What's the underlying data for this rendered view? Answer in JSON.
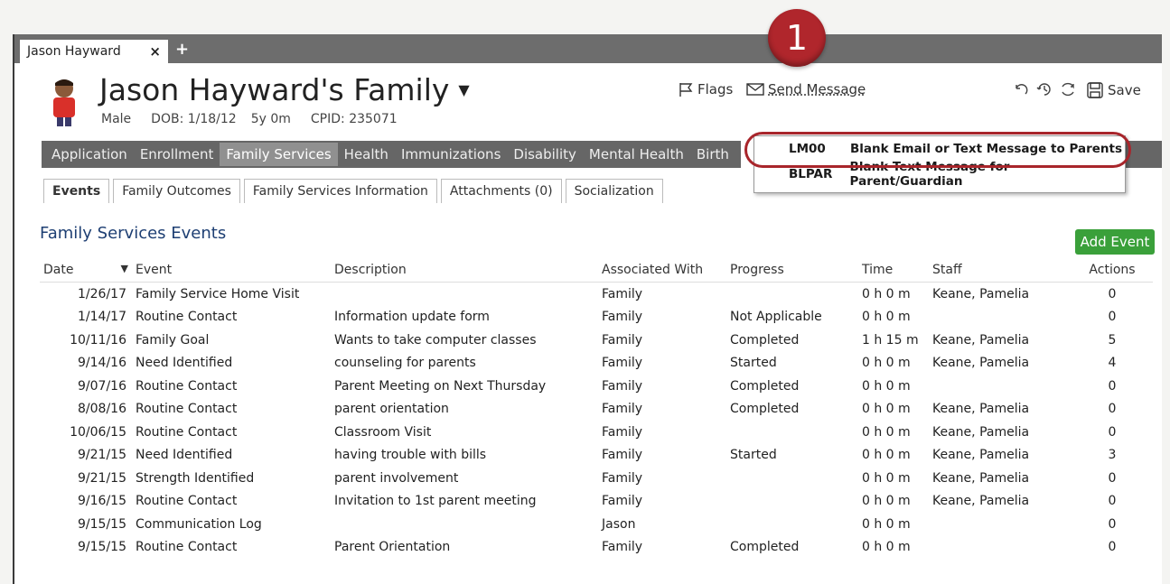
{
  "tabbar": {
    "tab_label": "Jason Hayward",
    "close_glyph": "×",
    "new_tab_glyph": "+"
  },
  "header": {
    "title": "Jason Hayward's Family",
    "gender": "Male",
    "dob": "DOB: 1/18/12",
    "age": "5y 0m",
    "cpid": "CPID: 235071"
  },
  "toolbar": {
    "flags_label": "Flags",
    "send_message_label": "Send Message",
    "save_label": "Save"
  },
  "nav": {
    "items": [
      "Application",
      "Enrollment",
      "Family Services",
      "Health",
      "Immunizations",
      "Disability",
      "Mental Health",
      "Birth"
    ],
    "active_index": 2
  },
  "subtabs": {
    "items": [
      "Events",
      "Family Outcomes",
      "Family Services Information",
      "Attachments (0)",
      "Socialization"
    ],
    "active_index": 0
  },
  "section": {
    "title": "Family Services Events",
    "add_button": "Add Event"
  },
  "table": {
    "headers": [
      "Date",
      "Event",
      "Description",
      "Associated With",
      "Progress",
      "Time",
      "Staff",
      "Actions"
    ],
    "rows": [
      [
        "1/26/17",
        "Family Service Home Visit",
        "",
        "Family",
        "",
        "0 h 0 m",
        "Keane, Pamelia",
        "0"
      ],
      [
        "1/14/17",
        "Routine Contact",
        "Information update form",
        "Family",
        "Not Applicable",
        "0 h 0 m",
        "",
        "0"
      ],
      [
        "10/11/16",
        "Family Goal",
        "Wants to take computer classes",
        "Family",
        "Completed",
        "1 h 15 m",
        "Keane, Pamelia",
        "5"
      ],
      [
        "9/14/16",
        "Need Identified",
        "counseling for parents",
        "Family",
        "Started",
        "0 h 0 m",
        "Keane, Pamelia",
        "4"
      ],
      [
        "9/07/16",
        "Routine Contact",
        "Parent Meeting on Next Thursday",
        "Family",
        "Completed",
        "0 h 0 m",
        "",
        "0"
      ],
      [
        "8/08/16",
        "Routine Contact",
        "parent orientation",
        "Family",
        "Completed",
        "0 h 0 m",
        "Keane, Pamelia",
        "0"
      ],
      [
        "10/06/15",
        "Routine Contact",
        "Classroom Visit",
        "Family",
        "",
        "0 h 0 m",
        "Keane, Pamelia",
        "0"
      ],
      [
        "9/21/15",
        "Need Identified",
        "having trouble with bills",
        "Family",
        "Started",
        "0 h 0 m",
        "Keane, Pamelia",
        "3"
      ],
      [
        "9/21/15",
        "Strength Identified",
        "parent involvement",
        "Family",
        "",
        "0 h 0 m",
        "Keane, Pamelia",
        "0"
      ],
      [
        "9/16/15",
        "Routine Contact",
        "Invitation to 1st parent meeting",
        "Family",
        "",
        "0 h 0 m",
        "Keane, Pamelia",
        "0"
      ],
      [
        "9/15/15",
        "Communication Log",
        "",
        "Jason",
        "",
        "0 h 0 m",
        "",
        "0"
      ],
      [
        "9/15/15",
        "Routine Contact",
        "Parent Orientation",
        "Family",
        "Completed",
        "0 h 0 m",
        "",
        "0"
      ]
    ]
  },
  "dropdown": {
    "items": [
      {
        "code": "LM00",
        "label": "Blank Email or Text Message to Parents"
      },
      {
        "code": "BLPAR",
        "label": "Blank Text Message for Parent/Guardian"
      }
    ]
  },
  "callout": {
    "number": "1"
  },
  "icons": {
    "flag": "flag-icon",
    "envelope": "envelope-icon",
    "undo": "undo-icon",
    "history": "history-icon",
    "refresh": "refresh-icon",
    "save": "save-icon",
    "sort": "sort-desc-icon"
  }
}
